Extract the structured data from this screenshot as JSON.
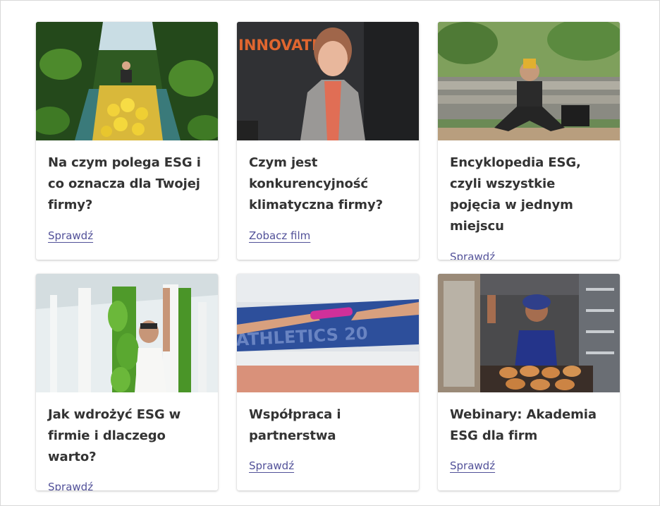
{
  "cards": [
    {
      "title": "Na czym polega ESG i co oznacza dla Twojej firmy?",
      "link": "Sprawdź",
      "image": "greenhouse-peppers-photo"
    },
    {
      "title": "Czym jest konkurencyjność klimatyczna firmy?",
      "link": "Zobacz film",
      "image": "woman-innovation-photo",
      "image_text": "INNOVATION"
    },
    {
      "title": "Encyklopedia ESG, czyli wszystkie pojęcia w jednym miejscu",
      "link": "Sprawdź",
      "image": "woman-bench-reading-photo"
    },
    {
      "title": "Jak wdrożyć ESG w firmie i dlaczego warto?",
      "link": "Sprawdź",
      "image": "vertical-farm-photo"
    },
    {
      "title": "Współpraca i partnerstwa",
      "link": "Sprawdź",
      "image": "relay-baton-photo",
      "image_text": "ATHLETICS 20"
    },
    {
      "title": "Webinary: Akademia ESG dla firm",
      "link": "Sprawdź",
      "image": "bakery-chef-photo"
    }
  ],
  "colors": {
    "link": "#525199",
    "title": "#333333",
    "border": "#d9d9d9"
  }
}
